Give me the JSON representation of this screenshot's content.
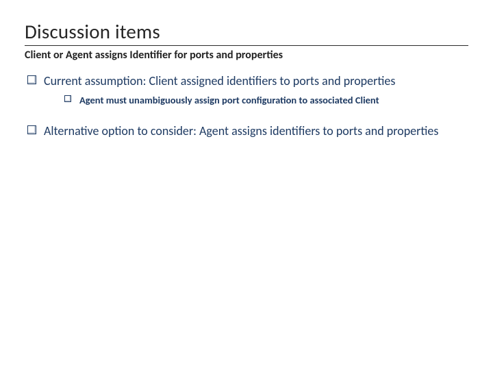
{
  "title": "Discussion items",
  "subtitle": "Client or Agent assigns Identifier for ports and properties",
  "bullets": [
    {
      "text": "Current assumption: Client assigned identifiers to ports and properties",
      "children": [
        {
          "text": "Agent must unambiguously assign port configuration to associated Client"
        }
      ]
    },
    {
      "text": "Alternative option to consider: Agent assigns identifiers to ports and properties",
      "children": []
    }
  ]
}
